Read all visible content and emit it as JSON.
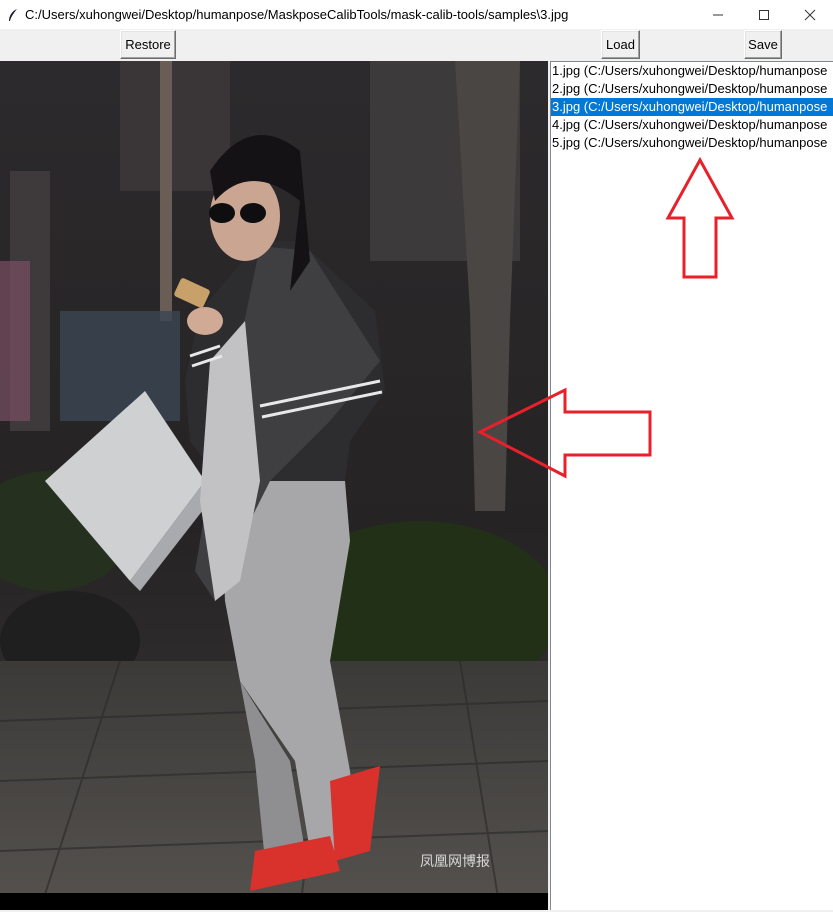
{
  "window": {
    "title": "C:/Users/xuhongwei/Desktop/humanpose/MaskposeCalibTools/mask-calib-tools/samples\\3.jpg",
    "controls": [
      "minimize-icon",
      "maximize-icon",
      "close-icon"
    ]
  },
  "toolbar": {
    "restore_label": "Restore",
    "load_label": "Load",
    "save_label": "Save"
  },
  "canvas": {
    "watermark": "凤凰网博报"
  },
  "file_list": {
    "selected_index": 2,
    "items": [
      "1.jpg (C:/Users/xuhongwei/Desktop/humanpose",
      "2.jpg (C:/Users/xuhongwei/Desktop/humanpose",
      "3.jpg (C:/Users/xuhongwei/Desktop/humanpose",
      "4.jpg (C:/Users/xuhongwei/Desktop/humanpose",
      "5.jpg (C:/Users/xuhongwei/Desktop/humanpose"
    ]
  },
  "colors": {
    "selection": "#0078d7",
    "annotation_arrow": "#e8202a",
    "canvas_bg": "#000000"
  }
}
